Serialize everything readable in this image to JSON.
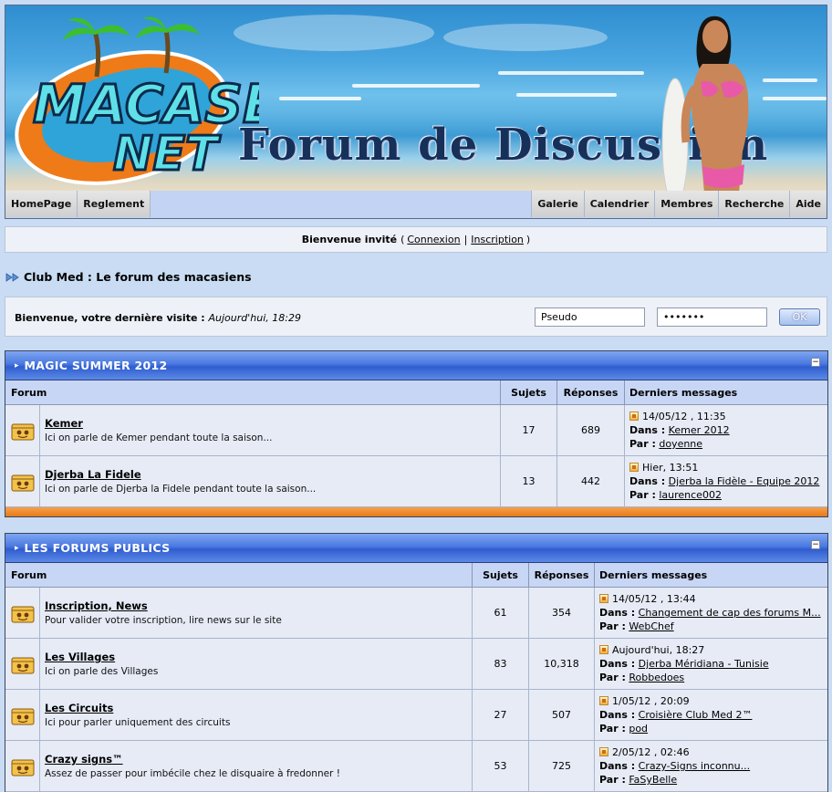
{
  "banner": {
    "logo_line1": "MACASE",
    "logo_line2": "NET",
    "title": "Forum de Discussion"
  },
  "nav": {
    "left": [
      "HomePage",
      "Reglement"
    ],
    "right": [
      "Galerie",
      "Calendrier",
      "Membres",
      "Recherche",
      "Aide"
    ]
  },
  "welcome": {
    "prefix": "Bienvenue invité",
    "open": "(",
    "login_link": "Connexion",
    "separator": "|",
    "register_link": "Inscription",
    "close": ")"
  },
  "breadcrumb": "Club Med : Le forum des macasiens",
  "login": {
    "label": "Bienvenue, votre dernière visite :",
    "last_visit": "Aujourd'hui, 18:29",
    "username_value": "Pseudo",
    "password_value": "•••••••",
    "ok_label": "OK"
  },
  "columns": {
    "forum": "Forum",
    "topics": "Sujets",
    "replies": "Réponses",
    "last": "Derniers messages",
    "in_label": "Dans :",
    "by_label": "Par :"
  },
  "categories": [
    {
      "title": "MAGIC SUMMER 2012",
      "forums": [
        {
          "name": "Kemer",
          "desc": "Ici on parle de Kemer pendant toute la saison...",
          "topics": "17",
          "replies": "689",
          "last_date": "14/05/12 , 11:35",
          "last_in": "Kemer 2012",
          "last_by": "doyenne"
        },
        {
          "name": "Djerba La Fidele",
          "desc": "Ici on parle de Djerba la Fidele pendant toute la saison...",
          "topics": "13",
          "replies": "442",
          "last_date": "Hier, 13:51",
          "last_in": "Djerba la Fidèle - Equipe 2012",
          "last_by": "laurence002"
        }
      ]
    },
    {
      "title": "LES FORUMS PUBLICS",
      "forums": [
        {
          "name": "Inscription, News",
          "desc": "Pour valider votre inscription, lire news sur le site",
          "topics": "61",
          "replies": "354",
          "last_date": "14/05/12 , 13:44",
          "last_in": "Changement de cap des forums M...",
          "last_by": "WebChef"
        },
        {
          "name": "Les Villages",
          "desc": "Ici on parle des Villages",
          "topics": "83",
          "replies": "10,318",
          "last_date": "Aujourd'hui, 18:27",
          "last_in": "Djerba Méridiana - Tunisie",
          "last_by": "Robbedoes"
        },
        {
          "name": "Les Circuits",
          "desc": "Ici pour parler uniquement des circuits",
          "topics": "27",
          "replies": "507",
          "last_date": "1/05/12 , 20:09",
          "last_in": "Croisière Club Med 2™",
          "last_by": "pod"
        },
        {
          "name": "Crazy signs™",
          "desc": "Assez de passer pour imbécile chez le disquaire à fredonner !",
          "topics": "53",
          "replies": "725",
          "last_date": "2/05/12 , 02:46",
          "last_in": "Crazy-Signs inconnu...",
          "last_by": "FaSyBelle"
        }
      ]
    }
  ]
}
